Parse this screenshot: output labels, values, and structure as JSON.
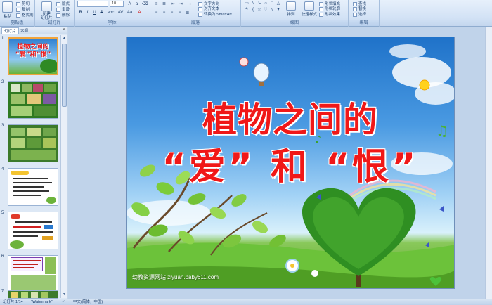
{
  "ribbon": {
    "clipboard": {
      "paste_label": "粘贴",
      "cut_label": "剪切",
      "copy_label": "复制",
      "format_painter_label": "格式刷",
      "group_label": "剪贴板"
    },
    "slides": {
      "new_slide_label": "新建\n幻灯片",
      "layout_label": "版式",
      "reset_label": "重设",
      "delete_label": "删除",
      "group_label": "幻灯片"
    },
    "font": {
      "font_size_value": "10",
      "group_label": "字体",
      "bold": "B",
      "italic": "I",
      "underline": "U",
      "strike": "S",
      "shadow": "abc",
      "spacing": "AV",
      "case": "Aa",
      "color": "A"
    },
    "paragraph": {
      "text_direction_label": "文字方向",
      "align_text_label": "对齐文本",
      "smartart_label": "转换为 SmartArt",
      "group_label": "段落"
    },
    "drawing": {
      "arrange_label": "排列",
      "quick_styles_label": "快速样式",
      "shape_fill_label": "形状填充",
      "shape_outline_label": "形状轮廓",
      "shape_effects_label": "形状效果",
      "group_label": "绘图"
    },
    "editing": {
      "find_label": "查找",
      "replace_label": "替换",
      "select_label": "选择",
      "group_label": "编辑"
    }
  },
  "panel": {
    "tab_slides": "幻灯片",
    "tab_outline": "大纲",
    "close_glyph": "×",
    "thumb_title_line1": "植物之间的",
    "thumb_title_line2": "“爱”和“恨”",
    "slides": [
      {
        "number": "1"
      },
      {
        "number": "2"
      },
      {
        "number": "3"
      },
      {
        "number": "4"
      },
      {
        "number": "5"
      },
      {
        "number": "6"
      },
      {
        "number": "7"
      }
    ]
  },
  "slide": {
    "title_line1": "植物之间的",
    "title_line2": "“爱” 和 “恨”",
    "footer": "幼教资源网站  ziyuan.baby611.com"
  },
  "status": {
    "slide_indicator": "幻灯片 1/14",
    "theme": "\"Watermark\"",
    "language": "中文(简体，中国)"
  },
  "colors": {
    "title_red": "#f01818",
    "ribbon_bg": "#d2e2f5",
    "selected_thumb_border": "#f1a43c"
  }
}
